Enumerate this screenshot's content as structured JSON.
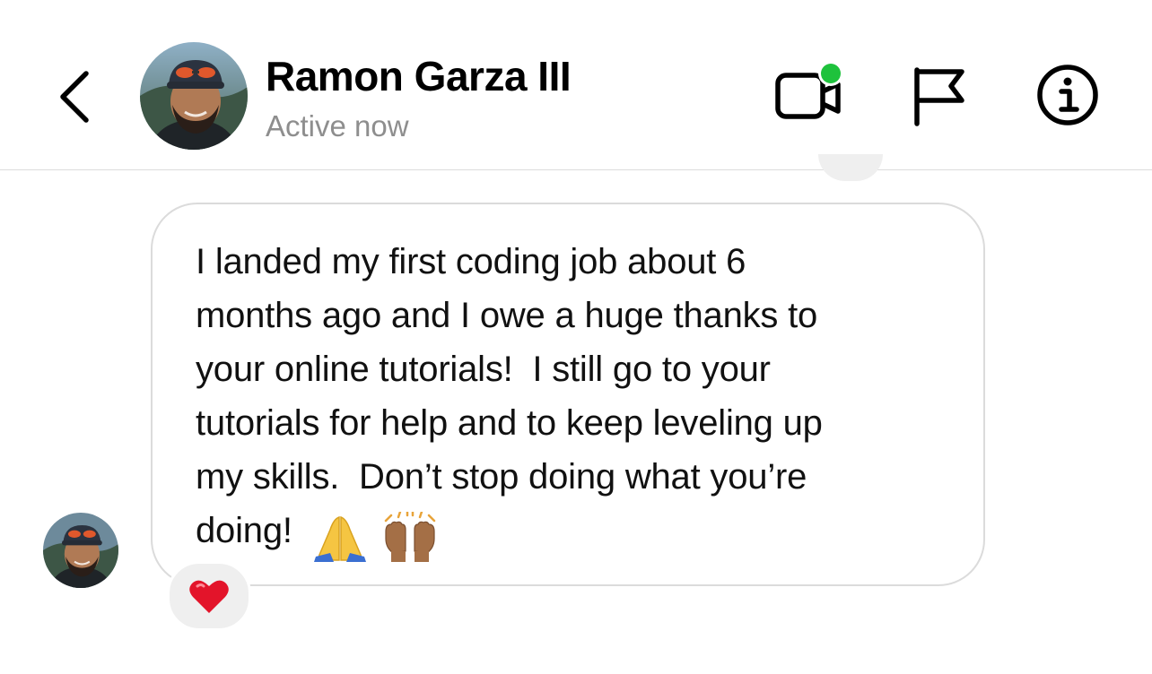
{
  "header": {
    "contact_name": "Ramon Garza III",
    "status": "Active now",
    "icons": {
      "back": "chevron-left-icon",
      "video": "video-call-icon",
      "flag": "flag-icon",
      "info": "info-icon"
    },
    "online_dot_color": "#1ec23c"
  },
  "message": {
    "from": "Ramon Garza III",
    "text": "I landed my first coding job about 6\nmonths ago and I owe a huge thanks to\nyour online tutorials!  I still go to your\ntutorials for help and to keep leveling up\nmy skills.  Don’t stop doing what you’re\ndoing!",
    "emojis": [
      "folded-hands-emoji",
      "raising-hands-emoji"
    ],
    "reaction": "red-heart-emoji"
  },
  "colors": {
    "bubble_border": "#dbdbdb",
    "secondary_text": "#8e8e8e",
    "reaction_bg": "#efefef",
    "divider": "#dcdcdc"
  }
}
